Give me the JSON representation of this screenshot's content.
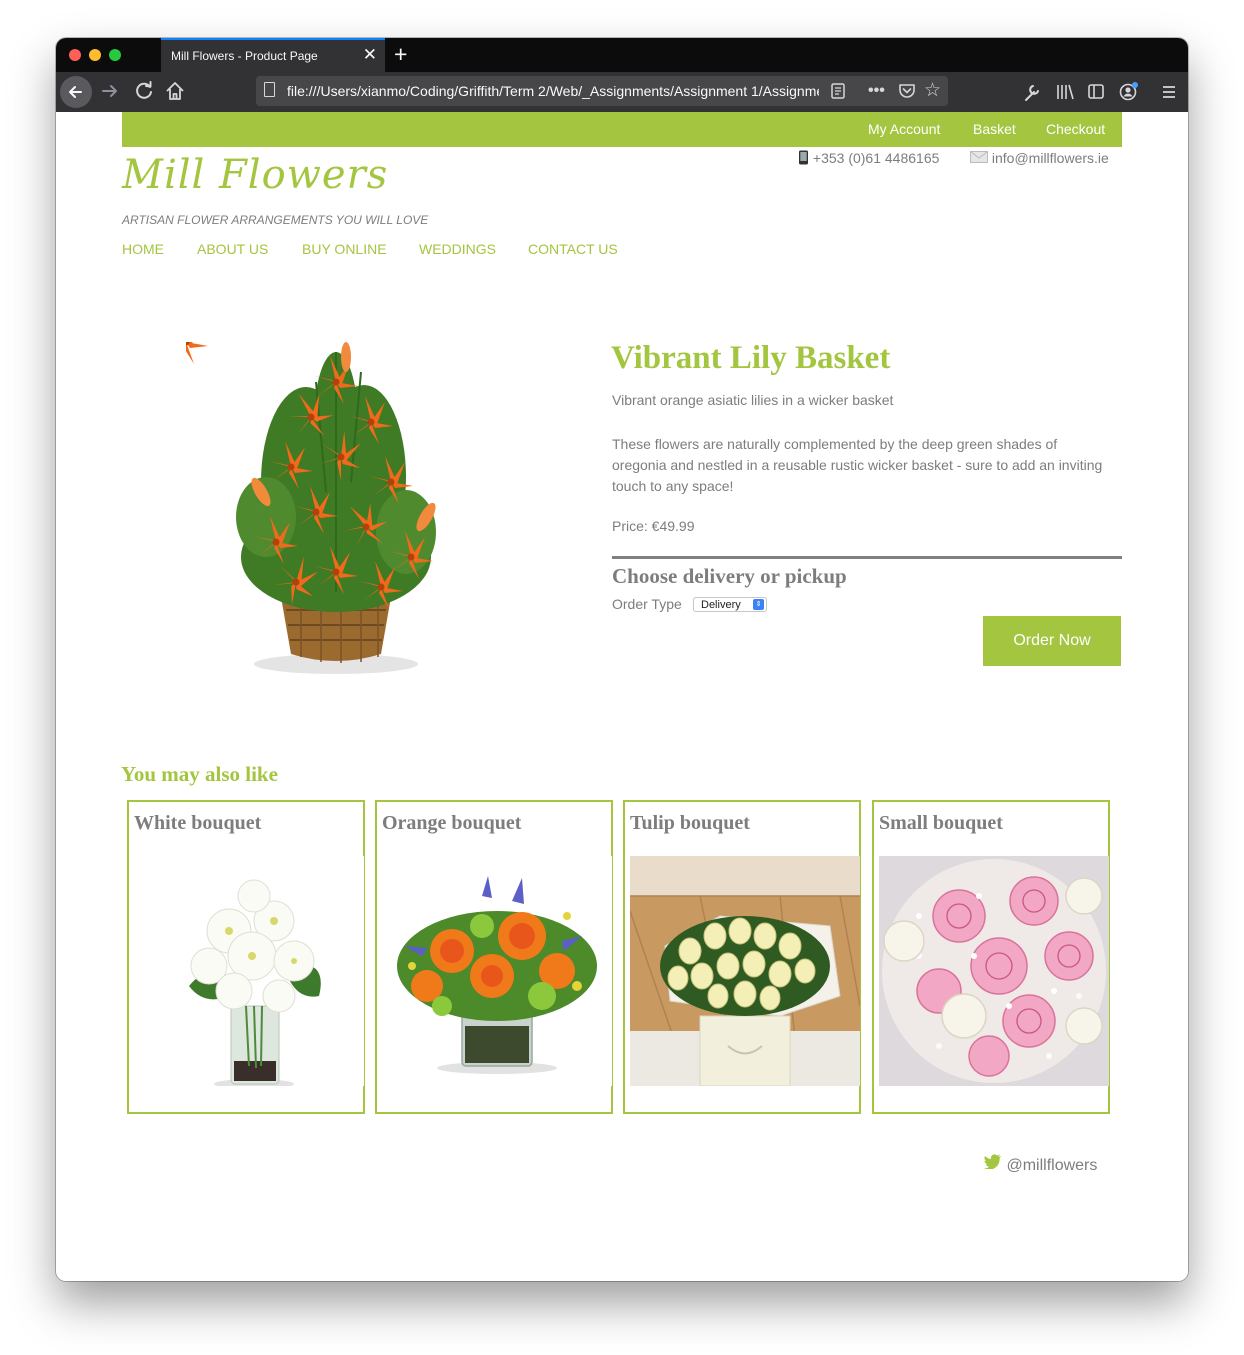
{
  "browser": {
    "tab_title": "Mill Flowers - Product Page",
    "tab_close": "✕",
    "new_tab": "+",
    "url": "file:///Users/xianmo/Coding/Griffith/Term 2/Web/_Assignments/Assignment 1/Assignment"
  },
  "site": {
    "top_links": [
      "My Account",
      "Basket",
      "Checkout"
    ],
    "phone": "+353 (0)61 4486165",
    "email": "info@millflowers.ie",
    "logo": "Mill Flowers",
    "tagline": "Artisan flower arrangements you will love",
    "nav": [
      "HOME",
      "ABOUT US",
      "BUY ONLINE",
      "WEDDINGS",
      "CONTACT US"
    ]
  },
  "product": {
    "title": "Vibrant Lily Basket",
    "subtitle": "Vibrant orange asiatic lilies in a wicker basket",
    "description": "These flowers are naturally complemented by the deep green shades of oregonia and nestled in a reusable rustic wicker basket - sure to add an inviting touch to any space!",
    "price": "Price: €49.99",
    "choose_heading": "Choose delivery or pickup",
    "order_type_label": "Order Type",
    "order_type_value": "Delivery",
    "order_button": "Order Now"
  },
  "related": {
    "heading": "You may also like",
    "items": [
      {
        "name": "White bouquet"
      },
      {
        "name": "Orange bouquet"
      },
      {
        "name": "Tulip bouquet"
      },
      {
        "name": "Small bouquet"
      }
    ]
  },
  "footer": {
    "twitter": "@millflowers"
  },
  "colors": {
    "brand_green": "#a3c540",
    "text_gray": "#7d7d7d",
    "browser_chrome": "#323234"
  }
}
